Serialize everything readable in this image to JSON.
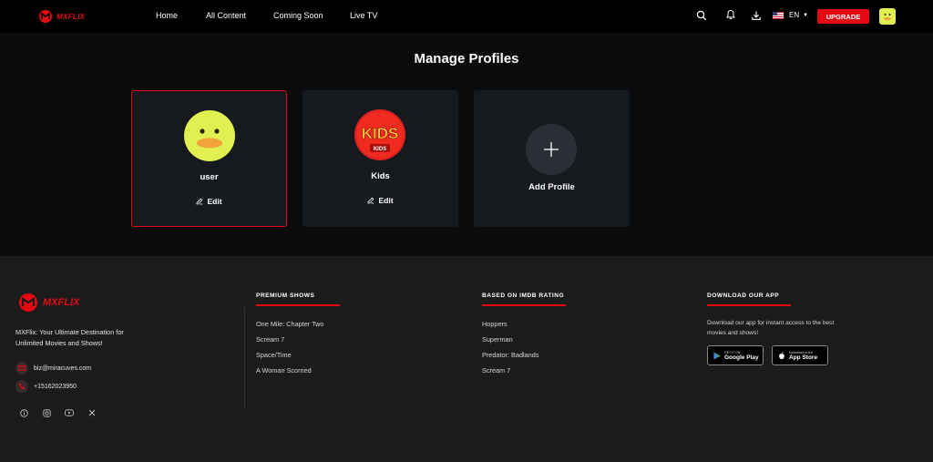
{
  "brand": {
    "name": "MXFLIX",
    "color": "#e50914"
  },
  "nav": {
    "items": [
      {
        "label": "Home"
      },
      {
        "label": "All Content"
      },
      {
        "label": "Coming Soon"
      },
      {
        "label": "Live TV"
      }
    ]
  },
  "header": {
    "icons": [
      "search-icon",
      "bell-icon",
      "download-icon"
    ],
    "language": "EN",
    "upgrade_label": "UPGRADE"
  },
  "main": {
    "title": "Manage Profiles",
    "profiles": [
      {
        "name": "user",
        "edit_label": "Edit",
        "selected": true,
        "avatar": "yellow-duck-avatar"
      },
      {
        "name": "Kids",
        "edit_label": "Edit",
        "selected": false,
        "avatar": "kids-avatar",
        "avatar_text": "KIDS",
        "avatar_subtext": "KIDS"
      }
    ],
    "add_profile_label": "Add Profile"
  },
  "footer": {
    "logo": "MXFLIX",
    "tagline": "MXFlix: Your Ultimate Destination for Unlimited Movies and Shows!",
    "email": "biz@miracuves.com",
    "phone": "+15162023950",
    "socials": [
      "info-icon",
      "instagram-icon",
      "youtube-icon",
      "x-icon"
    ],
    "premium_shows": {
      "heading": "PREMIUM SHOWS",
      "items": [
        "One Mile: Chapter Two",
        "Scream 7",
        "Space/Time",
        "A Woman Scorned"
      ]
    },
    "imdb": {
      "heading": "BASED ON IMDB RATING",
      "items": [
        "Hoppers",
        "Superman",
        "Predator: Badlands",
        "Scream 7"
      ]
    },
    "app": {
      "heading": "DOWNLOAD OUR APP",
      "text": "Download our app for instant access to the best movies and shows!",
      "google": {
        "small": "GET IT ON",
        "big": "Google Play"
      },
      "apple": {
        "small": "Download on the",
        "big": "App Store"
      }
    }
  }
}
